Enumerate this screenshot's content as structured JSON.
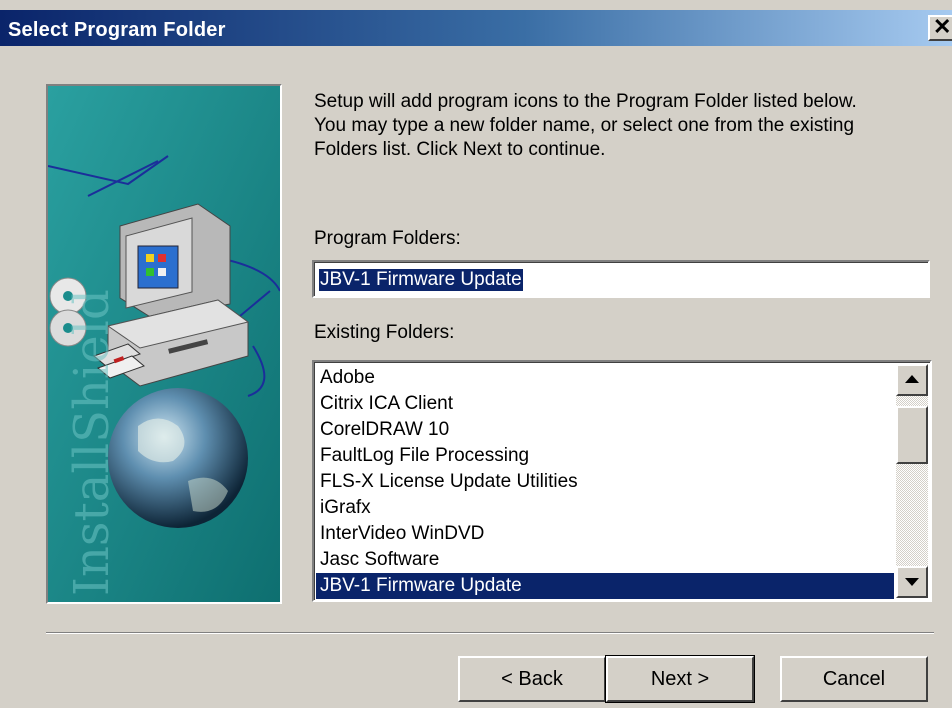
{
  "window": {
    "title": "Select Program Folder",
    "close_glyph": "✕"
  },
  "sidebar_image": {
    "brand_text": "InstallShield",
    "icons": [
      "computer-icon",
      "cd-disc-icon",
      "floppy-disk-icon",
      "globe-icon"
    ]
  },
  "description": "Setup will add program icons to the Program Folder listed below.\nYou may type a new folder name, or select one from the existing\nFolders list.  Click Next to continue.",
  "program_folders": {
    "label": "Program Folders:",
    "value": "JBV-1 Firmware Update"
  },
  "existing_folders": {
    "label": "Existing Folders:",
    "items": [
      {
        "label": "Adobe",
        "selected": false
      },
      {
        "label": "Citrix ICA Client",
        "selected": false
      },
      {
        "label": "CorelDRAW 10",
        "selected": false
      },
      {
        "label": "FaultLog File Processing",
        "selected": false
      },
      {
        "label": "FLS-X License Update Utilities",
        "selected": false
      },
      {
        "label": "iGrafx",
        "selected": false
      },
      {
        "label": "InterVideo WinDVD",
        "selected": false
      },
      {
        "label": "Jasc Software",
        "selected": false
      },
      {
        "label": "JBV-1 Firmware Update",
        "selected": true
      }
    ]
  },
  "buttons": {
    "back": "< Back",
    "next": "Next >",
    "cancel": "Cancel"
  },
  "colors": {
    "titlebar_start": "#0a246a",
    "titlebar_end": "#a6caf0",
    "dialog_face": "#d4d0c8",
    "selection": "#0a246a",
    "bitmap_teal": "#1a8c8c"
  }
}
